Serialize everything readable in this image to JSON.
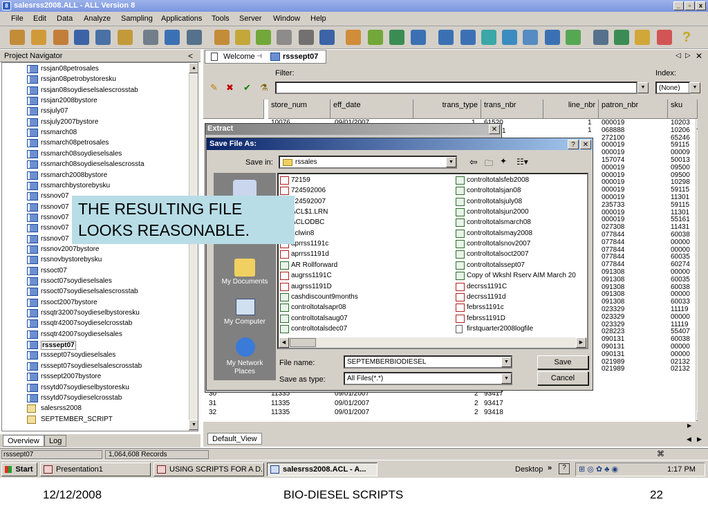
{
  "window": {
    "title": "salesrss2008.ALL - ALL Version 8",
    "app_icon": "8"
  },
  "menu": [
    "File",
    "Edit",
    "Data",
    "Analyze",
    "Sampling",
    "Applications",
    "Tools",
    "Server",
    "Window",
    "Help"
  ],
  "navigator": {
    "title": "Project Navigator",
    "collapse_label": "<",
    "items": [
      "rssjan08petrosales",
      "rssjan08petrobystoresku",
      "rssjan08soydieselsalescrosstab",
      "rssjan2008bystore",
      "rssjuly07",
      "rssjuly2007bystore",
      "rssmarch08",
      "rssmarch08petrosales",
      "rssmarch08soydieselsales",
      "rssmarch08soydieselsalescrossta",
      "rssmarch2008bystore",
      "rssmarchbystorebysku",
      "rssnov07",
      "rssnov07",
      "rssnov07",
      "rssnov07",
      "rssnov07",
      "rssnov2007bystore",
      "rssnovbystorebysku",
      "rssoct07",
      "rssoct07soydieselsales",
      "rssoct07soydieselsalescrosstab",
      "rssoct2007bystore",
      "rssqtr32007soydieselbystoresku",
      "rssqtr42007soydieselcrosstab",
      "rssqtr42007soydieselsales",
      "rsssept07",
      "rsssept07soydieselsales",
      "rsssept07soydieselsalescrosstab",
      "rsssept2007bystore",
      "rssytd07soydieselbystoresku",
      "rssytd07soydieselcrosstab",
      "salesrss2008",
      "SEPTEMBER_SCRIPT"
    ],
    "selected": "rsssept07",
    "tabs": [
      "Overview",
      "Log"
    ]
  },
  "doc_tabs": [
    "Welcome",
    "rsssept07"
  ],
  "filter": {
    "label": "Filter:",
    "value": ""
  },
  "index": {
    "label": "Index:",
    "value": "(None)"
  },
  "grid": {
    "columns": [
      "store_num",
      "eff_date",
      "trans_type",
      "trans_nbr",
      "line_nbr",
      "patron_nbr",
      "sku"
    ],
    "right_col": {
      "patron": [
        "000019",
        "068888",
        "272100",
        "000019",
        "000019",
        "157074",
        "000019",
        "000019",
        "000019",
        "000019",
        "000019",
        "235733",
        "000019",
        "000019",
        "027308",
        "077844",
        "077844",
        "077844",
        "077844",
        "077844",
        "091308",
        "091308",
        "091308",
        "091308",
        "091308",
        "023329",
        "023329",
        "023329",
        "028223",
        "090131",
        "090131",
        "090131",
        "021989",
        "021989"
      ],
      "sku": [
        "10203",
        "10206",
        "65246",
        "59115",
        "00009",
        "50013",
        "09500",
        "09500",
        "10298",
        "59115",
        "11301",
        "59115",
        "11301",
        "55161",
        "11431",
        "60038",
        "00000",
        "00000",
        "60035",
        "60274",
        "00000",
        "60035",
        "60038",
        "00000",
        "60033",
        "11119",
        "00000",
        "11119",
        "55407",
        "60038",
        "00000",
        "00000",
        "02132",
        "02132"
      ],
      "line": [
        "1",
        "1",
        "",
        "",
        "2",
        "",
        "",
        "2",
        "",
        "",
        "",
        "",
        "",
        "",
        "",
        "",
        "2",
        "",
        "",
        "",
        "",
        "2",
        "3",
        "",
        "",
        "",
        "2",
        "3",
        "",
        "",
        "2",
        "3",
        "1",
        ""
      ],
      "partial_trans": [
        "61520",
        "1"
      ]
    },
    "bottom_rows": [
      {
        "row": "30",
        "store": "11335",
        "date": "09/01/2007",
        "type": "2",
        "trans": "93417",
        "line": "2",
        "patron": "090131",
        "sku": "00000"
      },
      {
        "row": "31",
        "store": "11335",
        "date": "09/01/2007",
        "type": "2",
        "trans": "93417",
        "line": "3",
        "patron": "090131",
        "sku": "00000"
      },
      {
        "row": "32",
        "store": "11335",
        "date": "09/01/2007",
        "type": "2",
        "trans": "93418",
        "line": "1",
        "patron": "021989",
        "sku": "02132"
      }
    ],
    "first_row": {
      "store": "10076",
      "date": "09/01/2007",
      "type": "1"
    },
    "view_tab": "Default_View"
  },
  "extract_dialog": {
    "title": "Extract"
  },
  "save_dialog": {
    "title": "Save File As:",
    "save_in_label": "Save in:",
    "save_in_value": "rssales",
    "places": [
      "My Documents",
      "My Computer",
      "My Network Places"
    ],
    "files_col1": [
      "72159",
      "724592006",
      "724592007",
      "ACL$1.LRN",
      "ACLODBC",
      "aclwin8",
      "aprrss1191c",
      "aprrss1191d",
      "AR Rollforward",
      "augrss1191C",
      "augrss1191D",
      "cashdiscount9months",
      "controltotalsapr08",
      "controltotalsaug07",
      "controltotalsdec07"
    ],
    "files_col2": [
      "controltotalsfeb2008",
      "controltotalsjan08",
      "controltotalsjuly08",
      "controltotalsjun2000",
      "controltotalsmarch08",
      "controltotalsmay2008",
      "controltotalsnov2007",
      "controltotalsoct2007",
      "controltotalssept07",
      "Copy of Wkshl Rserv AIM March 20",
      "decrss1191C",
      "decrss1191d",
      "febrss1191c",
      "febrss1191D",
      "firstquarter2008logfile"
    ],
    "file_name_label": "File name:",
    "file_name_value": "SEPTEMBERBIODIESEL",
    "save_type_label": "Save as type:",
    "save_type_value": "All Files(*.*)",
    "save_button": "Save",
    "cancel_button": "Cancel"
  },
  "callout": {
    "line1": "THE RESULTING FILE",
    "line2": "LOOKS REASONABLE."
  },
  "statusbar": {
    "table": "rsssept07",
    "records": "1,064,608 Records"
  },
  "taskbar": {
    "start": "Start",
    "tasks": [
      "Presentation1",
      "USING SCRIPTS FOR A D...",
      "salesrss2008.ACL - A..."
    ],
    "desktop": "Desktop",
    "time": "1:17 PM"
  },
  "slide_footer": {
    "date": "12/12/2008",
    "title": "BIO-DIESEL SCRIPTS",
    "page": "22"
  }
}
